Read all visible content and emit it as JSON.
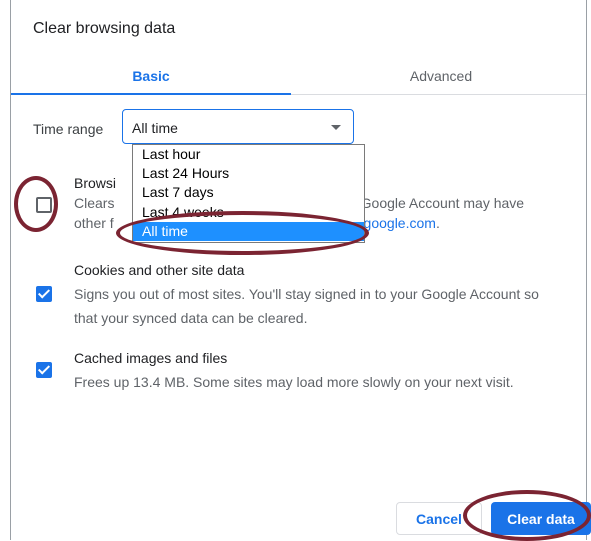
{
  "dialog": {
    "title": "Clear browsing data"
  },
  "tabs": [
    {
      "label": "Basic"
    },
    {
      "label": "Advanced"
    }
  ],
  "time_range": {
    "label": "Time range",
    "selected": "All time",
    "options": [
      "Last hour",
      "Last 24 Hours",
      "Last 7 days",
      "Last 4 weeks",
      "All time"
    ]
  },
  "items": [
    {
      "title": "Browsi",
      "desc_line1_start": "Clears",
      "desc_line1_end": "Your Google Account may have",
      "desc_line2_start": "other f",
      "desc_line2_link": "vity.google.com",
      "desc_line2_end": ".",
      "checked": false
    },
    {
      "title": "Cookies and other site data",
      "desc_line1": "Signs you out of most sites. You'll stay signed in to your Google Account so",
      "desc_line2": "that your synced data can be cleared.",
      "checked": true
    },
    {
      "title": "Cached images and files",
      "desc_line1": "Frees up 13.4 MB. Some sites may load more slowly on your next visit.",
      "checked": true
    }
  ],
  "buttons": {
    "cancel": "Cancel",
    "clear": "Clear data"
  },
  "colors": {
    "accent": "#1a73e8",
    "highlight": "#1e90ff",
    "annotation_ring": "#7b2432"
  }
}
